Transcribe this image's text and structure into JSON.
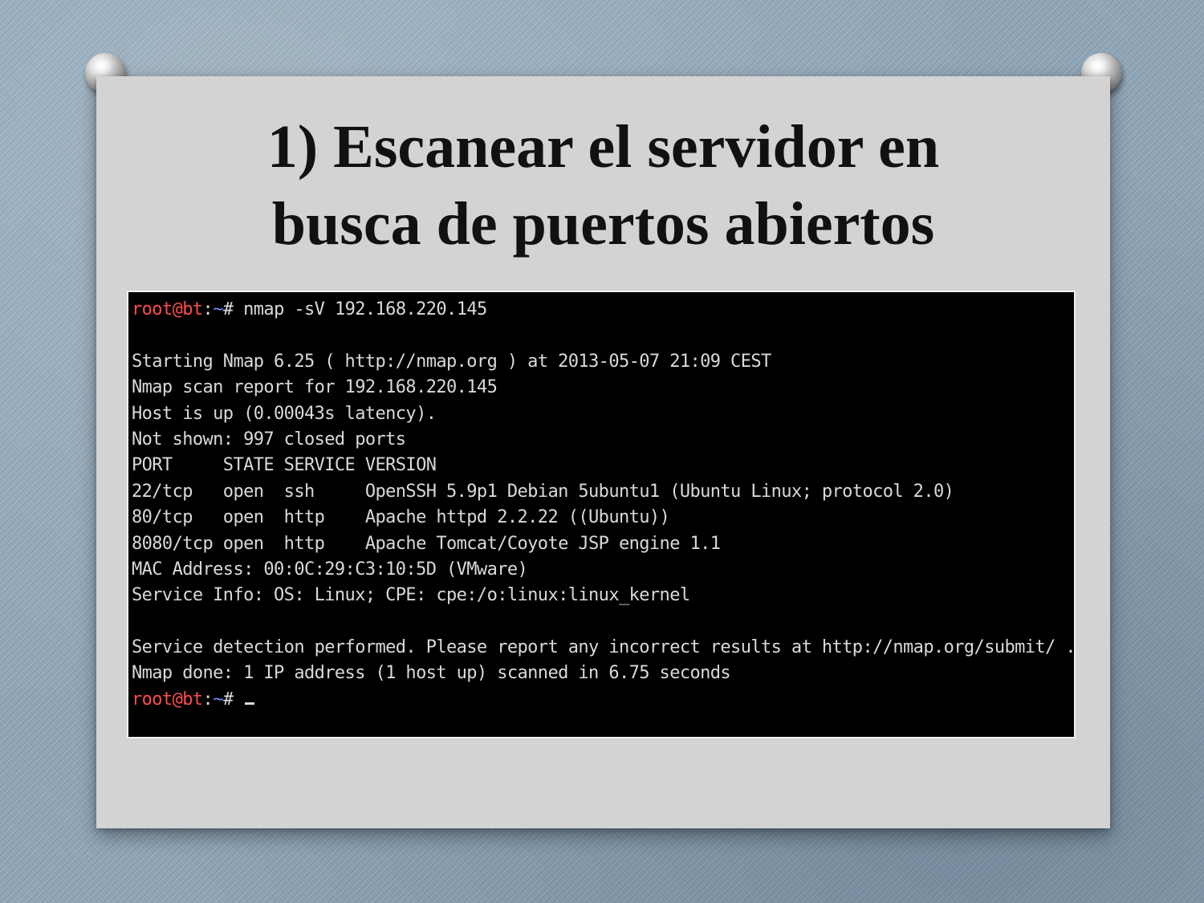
{
  "slide": {
    "title_line1": "1) Escanear el servidor en",
    "title_line2": "busca de puertos abiertos"
  },
  "terminal": {
    "prompt_user": "root@bt",
    "prompt_sep": ":",
    "prompt_path": "~",
    "prompt_symbol": "#",
    "command": " nmap -sV 192.168.220.145",
    "output": [
      "",
      "Starting Nmap 6.25 ( http://nmap.org ) at 2013-05-07 21:09 CEST",
      "Nmap scan report for 192.168.220.145",
      "Host is up (0.00043s latency).",
      "Not shown: 997 closed ports",
      "PORT     STATE SERVICE VERSION",
      "22/tcp   open  ssh     OpenSSH 5.9p1 Debian 5ubuntu1 (Ubuntu Linux; protocol 2.0)",
      "80/tcp   open  http    Apache httpd 2.2.22 ((Ubuntu))",
      "8080/tcp open  http    Apache Tomcat/Coyote JSP engine 1.1",
      "MAC Address: 00:0C:29:C3:10:5D (VMware)",
      "Service Info: OS: Linux; CPE: cpe:/o:linux:linux_kernel",
      "",
      "Service detection performed. Please report any incorrect results at http://nmap.org/submit/ .",
      "Nmap done: 1 IP address (1 host up) scanned in 6.75 seconds"
    ]
  },
  "colors": {
    "background": "#8fa6b8",
    "card": "#d3d3d3",
    "terminal_bg": "#000000",
    "terminal_text": "#d9d9d9",
    "prompt_user": "#ff4b4b",
    "prompt_path": "#6f8cff"
  },
  "icons": [
    "pushpin-icon",
    "pushpin-icon"
  ]
}
